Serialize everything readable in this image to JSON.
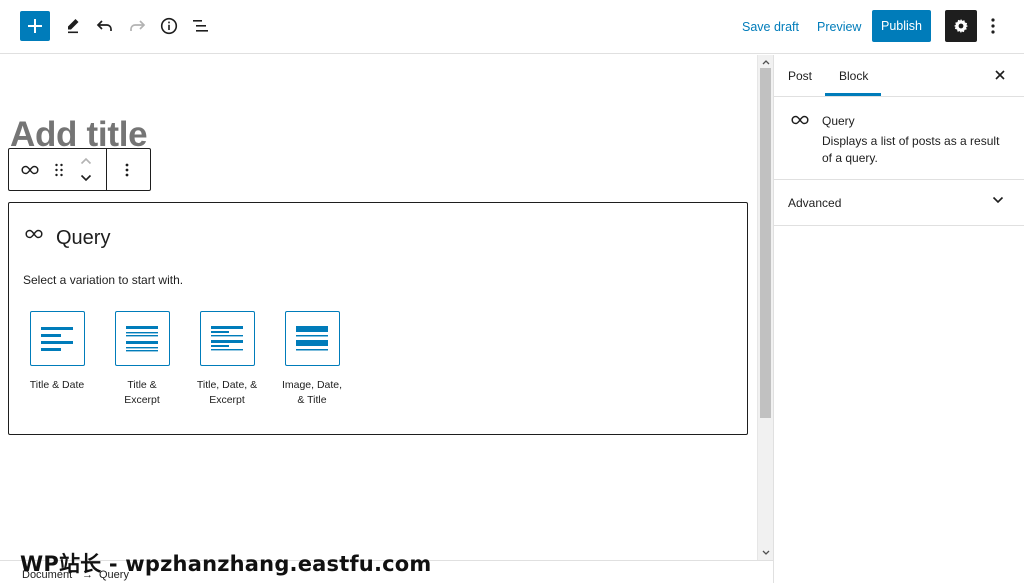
{
  "toolbar": {
    "add_icon": "plus-icon",
    "tools_icon": "pencil-icon",
    "undo_icon": "undo-icon",
    "redo_icon": "redo-icon",
    "info_icon": "info-icon",
    "outline_icon": "list-view-icon",
    "save_draft_label": "Save draft",
    "preview_label": "Preview",
    "publish_label": "Publish",
    "settings_icon": "gear-icon",
    "more_icon": "more-vertical-icon"
  },
  "editor": {
    "title_placeholder": "Add title",
    "block_toolbar": {
      "block_icon": "loop-icon",
      "drag_icon": "drag-handle-icon",
      "move_up_icon": "chevron-up-icon",
      "move_down_icon": "chevron-down-icon",
      "options_icon": "more-vertical-icon"
    },
    "query_block": {
      "title": "Query",
      "instructions": "Select a variation to start with.",
      "variations": [
        {
          "label": "Title & Date"
        },
        {
          "label": "Title & Excerpt"
        },
        {
          "label": "Title, Date, & Excerpt"
        },
        {
          "label": "Image, Date, & Title"
        }
      ]
    }
  },
  "sidebar": {
    "tabs": [
      {
        "label": "Post"
      },
      {
        "label": "Block"
      }
    ],
    "active_tab": "Block",
    "block_card": {
      "title": "Query",
      "description": "Displays a list of posts as a result of a query."
    },
    "advanced_label": "Advanced"
  },
  "breadcrumb": {
    "items": [
      "Document",
      "Query"
    ],
    "separator": "→"
  },
  "watermark": "WP站长 - wpzhanzhang.eastfu.com",
  "colors": {
    "accent": "#007cba",
    "dark": "#1e1e1e",
    "title_placeholder": "#757575"
  }
}
